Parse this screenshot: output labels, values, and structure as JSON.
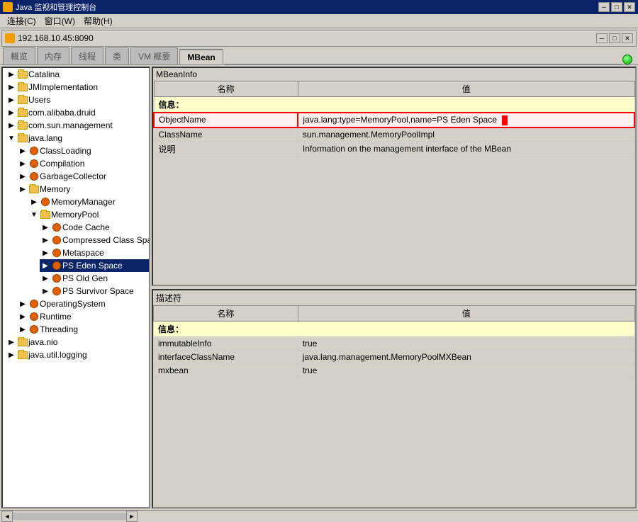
{
  "titleBar": {
    "title": "Java 监视和管理控制台",
    "icon": "java-icon",
    "minimize": "─",
    "maximize": "□",
    "close": "✕"
  },
  "menuBar": {
    "items": [
      "连接(C)",
      "窗口(W)",
      "帮助(H)"
    ]
  },
  "connectionBar": {
    "address": "192.168.10.45:8090"
  },
  "tabs": [
    {
      "label": "概览",
      "active": false
    },
    {
      "label": "内存",
      "active": false
    },
    {
      "label": "线程",
      "active": false
    },
    {
      "label": "类",
      "active": false
    },
    {
      "label": "VM 概要",
      "active": false
    },
    {
      "label": "MBean",
      "active": true
    }
  ],
  "tree": {
    "items": [
      {
        "id": "catalina",
        "label": "Catalina",
        "indent": 1,
        "type": "folder",
        "expanded": true
      },
      {
        "id": "jmimpl",
        "label": "JMImplementation",
        "indent": 1,
        "type": "folder",
        "expanded": false
      },
      {
        "id": "users",
        "label": "Users",
        "indent": 1,
        "type": "folder",
        "expanded": false
      },
      {
        "id": "alibaba",
        "label": "com.alibaba.druid",
        "indent": 1,
        "type": "folder",
        "expanded": false
      },
      {
        "id": "sun-mgmt",
        "label": "com.sun.management",
        "indent": 1,
        "type": "folder",
        "expanded": false
      },
      {
        "id": "java-lang",
        "label": "java.lang",
        "indent": 1,
        "type": "folder",
        "expanded": true
      },
      {
        "id": "classloading",
        "label": "ClassLoading",
        "indent": 2,
        "type": "mbean",
        "expanded": false
      },
      {
        "id": "compilation",
        "label": "Compilation",
        "indent": 2,
        "type": "mbean",
        "expanded": false
      },
      {
        "id": "gc",
        "label": "GarbageCollector",
        "indent": 2,
        "type": "mbean",
        "expanded": false
      },
      {
        "id": "memory",
        "label": "Memory",
        "indent": 2,
        "type": "folder",
        "expanded": false
      },
      {
        "id": "memorymgr",
        "label": "MemoryManager",
        "indent": 3,
        "type": "mbean",
        "expanded": false
      },
      {
        "id": "memorypool",
        "label": "MemoryPool",
        "indent": 3,
        "type": "folder",
        "expanded": true
      },
      {
        "id": "codecache",
        "label": "Code Cache",
        "indent": 4,
        "type": "mbean",
        "expanded": false
      },
      {
        "id": "compressedcls",
        "label": "Compressed Class Spa",
        "indent": 4,
        "type": "mbean",
        "expanded": false
      },
      {
        "id": "metaspace",
        "label": "Metaspace",
        "indent": 4,
        "type": "mbean",
        "expanded": false
      },
      {
        "id": "edenspace",
        "label": "PS Eden Space",
        "indent": 4,
        "type": "mbean",
        "expanded": false,
        "selected": true
      },
      {
        "id": "oldgen",
        "label": "PS Old Gen",
        "indent": 4,
        "type": "mbean",
        "expanded": false
      },
      {
        "id": "survivor",
        "label": "PS Survivor Space",
        "indent": 4,
        "type": "mbean",
        "expanded": false
      },
      {
        "id": "operatingsys",
        "label": "OperatingSystem",
        "indent": 2,
        "type": "mbean",
        "expanded": false
      },
      {
        "id": "runtime",
        "label": "Runtime",
        "indent": 2,
        "type": "mbean",
        "expanded": false
      },
      {
        "id": "threading",
        "label": "Threading",
        "indent": 2,
        "type": "mbean",
        "expanded": false
      },
      {
        "id": "java-nio",
        "label": "java.nio",
        "indent": 1,
        "type": "folder",
        "expanded": false
      },
      {
        "id": "java-logging",
        "label": "java.util.logging",
        "indent": 1,
        "type": "folder",
        "expanded": false
      }
    ]
  },
  "mbeanInfo": {
    "sectionTitle": "MBeanInfo",
    "tableHeaders": [
      "名称",
      "值"
    ],
    "infoLabel": "信息：",
    "rows": [
      {
        "name": "ObjectName",
        "value": "java.lang:type=MemoryPool,name=PS Eden Space",
        "selected": true
      },
      {
        "name": "ClassName",
        "value": "sun.management.MemoryPoolImpl"
      },
      {
        "name": "说明",
        "value": "Information on the management interface of the MBean"
      }
    ]
  },
  "descriptor": {
    "sectionTitle": "描述符",
    "tableHeaders": [
      "名称",
      "值"
    ],
    "infoLabel": "信息：",
    "rows": [
      {
        "name": "immutableInfo",
        "value": "true"
      },
      {
        "name": "interfaceClassName",
        "value": "java.lang.management.MemoryPoolMXBean"
      },
      {
        "name": "mxbean",
        "value": "true"
      }
    ]
  },
  "bottomScroll": {
    "leftArrow": "◄",
    "rightArrow": "►"
  }
}
